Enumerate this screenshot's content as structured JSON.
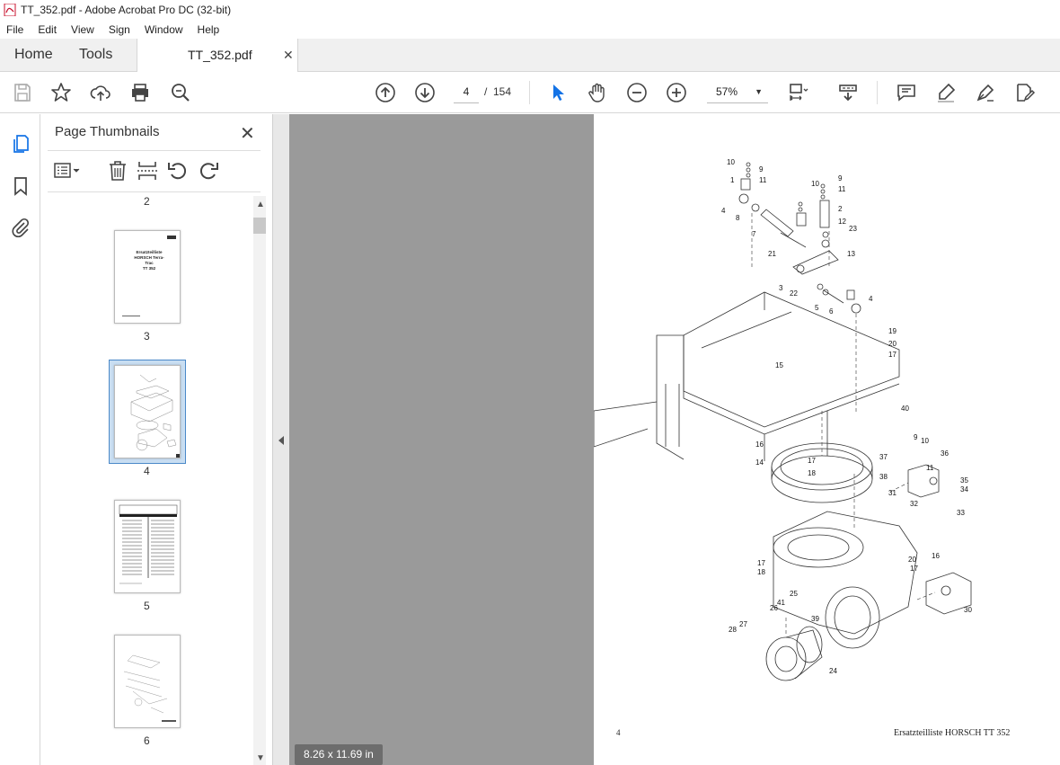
{
  "window": {
    "title": "TT_352.pdf - Adobe Acrobat Pro DC (32-bit)"
  },
  "menu": [
    "File",
    "Edit",
    "View",
    "Sign",
    "Window",
    "Help"
  ],
  "tabs": {
    "home": "Home",
    "tools": "Tools",
    "document": "TT_352.pdf"
  },
  "toolbar": {
    "current_page": "4",
    "page_separator": "/",
    "total_pages": "154",
    "zoom": "57%"
  },
  "thumbnails_panel": {
    "title": "Page Thumbnails",
    "pages": [
      {
        "label": "2"
      },
      {
        "label": "3",
        "title_lines": [
          "Ersatzteilliste",
          "HORSCH Terra-Trac",
          "TT 352"
        ]
      },
      {
        "label": "4",
        "selected": true
      },
      {
        "label": "5"
      },
      {
        "label": "6"
      }
    ]
  },
  "document": {
    "page_number": "4",
    "footer": "Ersatzteilliste HORSCH TT 352",
    "page_size": "8.26 x 11.69 in",
    "part_labels": [
      "10",
      "9",
      "11",
      "1",
      "4",
      "8",
      "7",
      "21",
      "10",
      "9",
      "11",
      "2",
      "12",
      "23",
      "13",
      "3",
      "22",
      "5",
      "6",
      "4",
      "19",
      "20",
      "17",
      "15",
      "40",
      "16",
      "17",
      "18",
      "14",
      "9",
      "10",
      "36",
      "37",
      "11",
      "38",
      "35",
      "34",
      "31",
      "32",
      "33",
      "17",
      "18",
      "25",
      "41",
      "26",
      "39",
      "27",
      "28",
      "24",
      "16",
      "20",
      "17",
      "30"
    ]
  },
  "colors": {
    "accent": "#1473e6",
    "doc_background": "#9a9a9a",
    "selected_thumb": "#c9def2"
  }
}
